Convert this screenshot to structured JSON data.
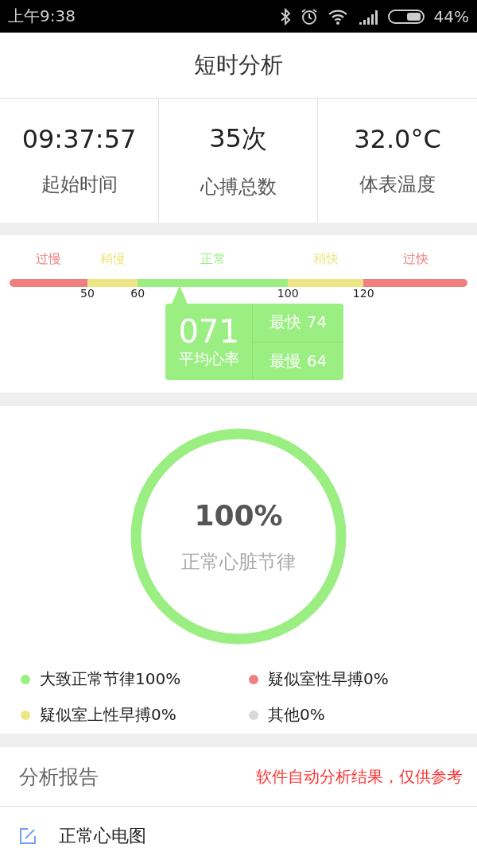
{
  "status_bar": {
    "time": "上午9:38",
    "battery": "44%"
  },
  "title": "短时分析",
  "stats": [
    {
      "value": "09:37:57",
      "label": "起始时间"
    },
    {
      "value": "35次",
      "label": "心搏总数"
    },
    {
      "value": "32.0°C",
      "label": "体表温度"
    }
  ],
  "zones": [
    {
      "label": "过慢",
      "color": "#f08080",
      "tick": "50"
    },
    {
      "label": "稍慢",
      "color": "#ede684",
      "tick": "60"
    },
    {
      "label": "正常",
      "color": "#9bef82",
      "tick": "100"
    },
    {
      "label": "稍快",
      "color": "#ede684",
      "tick": "120"
    },
    {
      "label": "过快",
      "color": "#f08080"
    }
  ],
  "heart_rate": {
    "average": "071",
    "average_label": "平均心率",
    "fastest": "最快 74",
    "slowest": "最慢 64"
  },
  "rhythm": {
    "percent": "100%",
    "label": "正常心脏节律"
  },
  "legend": [
    {
      "label": "大致正常节律100%",
      "color": "#9bef82"
    },
    {
      "label": "疑似室性早搏0%",
      "color": "#f08080"
    },
    {
      "label": "疑似室上性早搏0%",
      "color": "#ede684"
    },
    {
      "label": "其他0%",
      "color": "#d9d9d9"
    }
  ],
  "report": {
    "title": "分析报告",
    "note": "软件自动分析结果，仅供参考",
    "items": [
      "正常心电图"
    ]
  }
}
